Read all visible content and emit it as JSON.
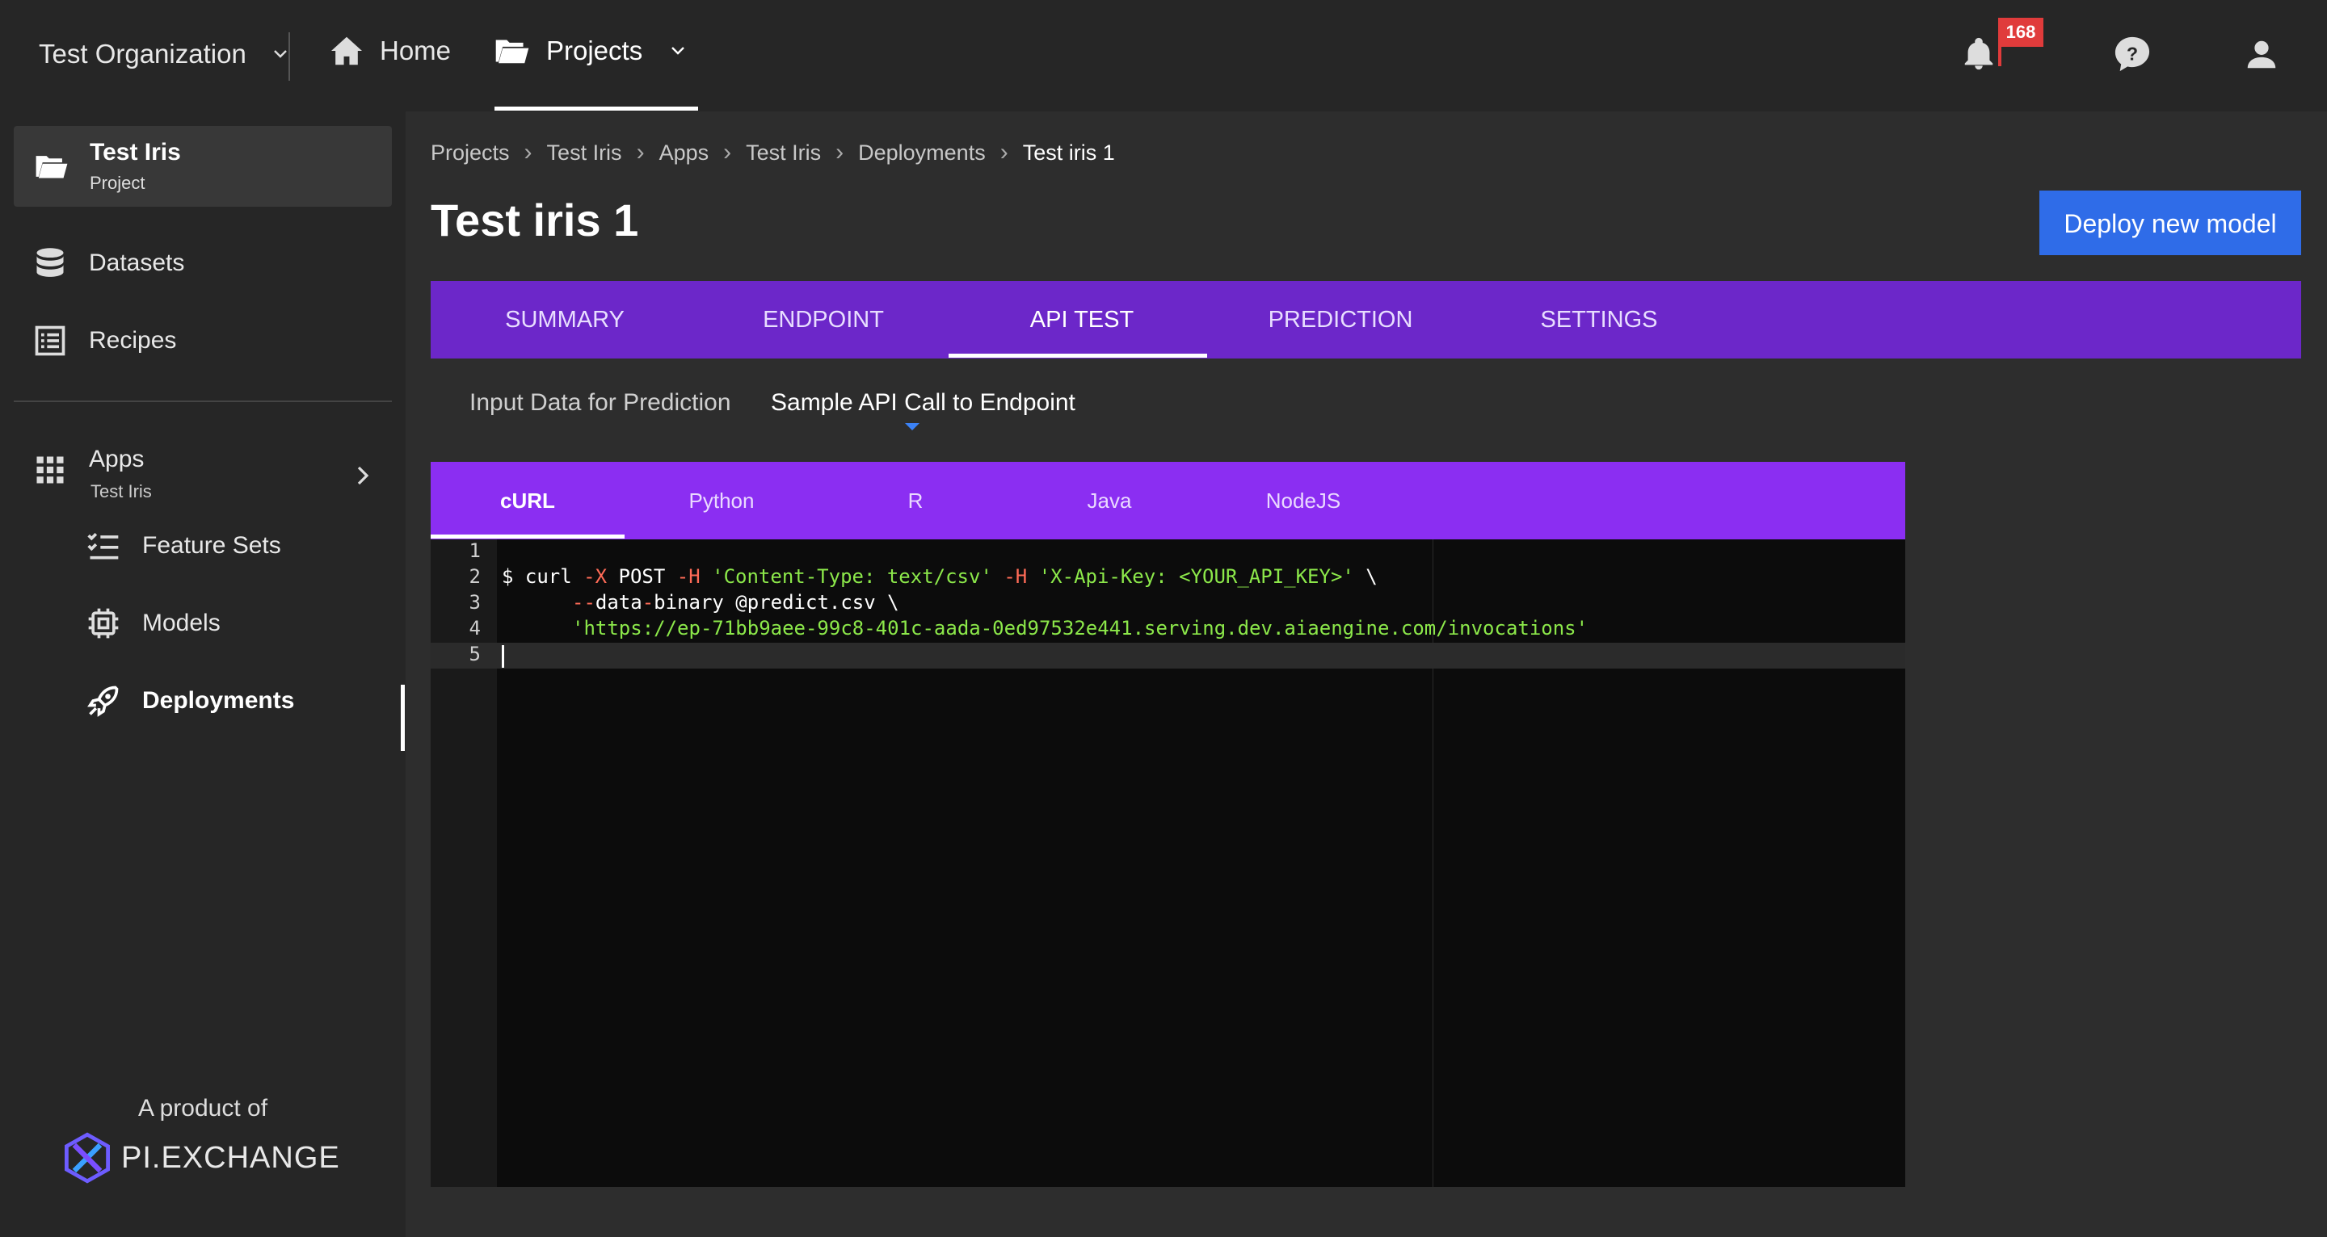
{
  "topbar": {
    "organization": "Test Organization",
    "home_label": "Home",
    "projects_label": "Projects",
    "notification_count": "168"
  },
  "sidebar": {
    "project_name": "Test Iris",
    "project_type": "Project",
    "items": [
      {
        "label": "Datasets",
        "icon": "database-icon"
      },
      {
        "label": "Recipes",
        "icon": "recipe-icon"
      }
    ],
    "apps": {
      "label": "Apps",
      "sub": "Test Iris"
    },
    "app_items": [
      {
        "label": "Feature Sets",
        "icon": "feature-sets-icon"
      },
      {
        "label": "Models",
        "icon": "chip-icon"
      },
      {
        "label": "Deployments",
        "icon": "rocket-icon",
        "active": true
      }
    ],
    "footer": {
      "product_of": "A product of",
      "brand": "PI.EXCHANGE"
    }
  },
  "breadcrumb": [
    "Projects",
    "Test Iris",
    "Apps",
    "Test Iris",
    "Deployments",
    "Test iris 1"
  ],
  "page": {
    "title": "Test iris 1",
    "deploy_button": "Deploy new model"
  },
  "tabs": [
    "SUMMARY",
    "ENDPOINT",
    "API TEST",
    "PREDICTION",
    "SETTINGS"
  ],
  "active_tab": "API TEST",
  "subtabs": [
    "Input Data for Prediction",
    "Sample API Call to Endpoint"
  ],
  "active_subtab": "Sample API Call to Endpoint",
  "lang_tabs": [
    "cURL",
    "Python",
    "R",
    "Java",
    "NodeJS"
  ],
  "active_lang_tab": "cURL",
  "editor": {
    "line_numbers": [
      "1",
      "2",
      "3",
      "4",
      "5"
    ],
    "line2": {
      "prompt": "$ curl ",
      "flag_x": "-X",
      "method": " POST ",
      "flag_h1": "-H",
      "header1": " 'Content-Type: text/csv' ",
      "flag_h2": "-H",
      "header2": " 'X-Api-Key: <YOUR_API_KEY>'",
      "cont": " \\"
    },
    "line3": {
      "flag": "--",
      "arg": "data",
      "dash": "-",
      "rest": "binary @predict.csv \\"
    },
    "line4": {
      "url": "'https://ep-71bb9aee-99c8-401c-aada-0ed97532e441.serving.dev.aiaengine.com/invocations'"
    }
  },
  "colors": {
    "tabs_bg": "#6c27c9",
    "lang_tabs_bg": "#8b2ef2",
    "primary_button": "#2f6ce8",
    "badge": "#e03b3b"
  }
}
